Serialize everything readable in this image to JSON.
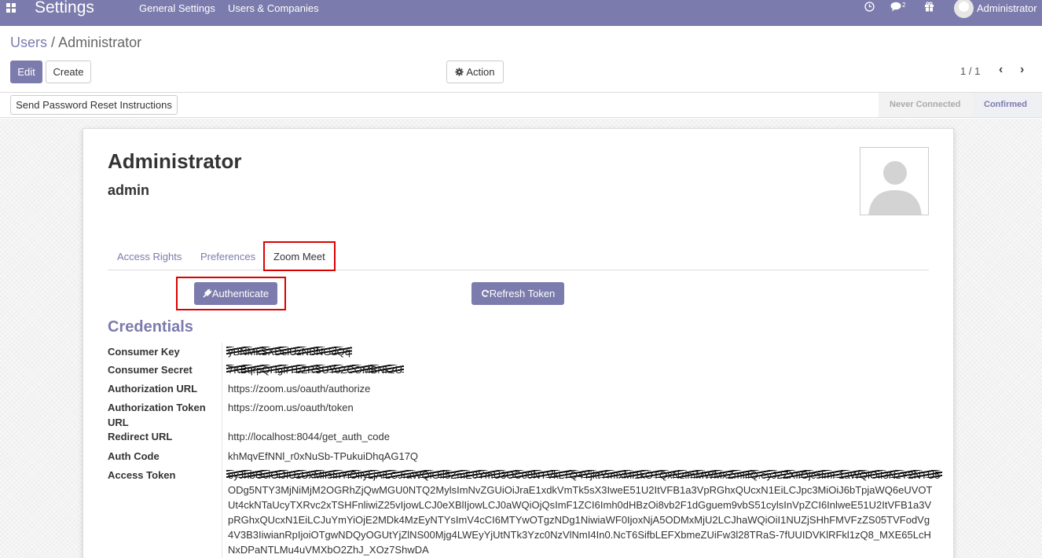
{
  "navbar": {
    "brand": "Settings",
    "menu": [
      "General Settings",
      "Users & Companies"
    ],
    "messages_count": "2",
    "user": "Administrator"
  },
  "breadcrumb": {
    "parent": "Users",
    "separator": "/",
    "current": "Administrator"
  },
  "buttons": {
    "edit": "Edit",
    "create": "Create",
    "action": "Action",
    "reset_password": "Send Password Reset Instructions",
    "authenticate": "Authenticate",
    "refresh_token": "Refresh Token"
  },
  "pager": {
    "value": "1 / 1"
  },
  "statusbar": {
    "never_connected": "Never Connected",
    "confirmed": "Confirmed"
  },
  "user": {
    "name": "Administrator",
    "login": "admin"
  },
  "tabs": [
    {
      "label": "Access Rights",
      "active": false
    },
    {
      "label": "Preferences",
      "active": false
    },
    {
      "label": "Zoom Meet",
      "active": true
    }
  ],
  "credentials": {
    "title": "Credentials",
    "consumer_key_label": "Consumer Key",
    "consumer_key": "yBNMkSXDsiUzNBNGdQq",
    "consumer_secret_label": "Consumer Secret",
    "consumer_secret": "7KBqrpQHgfrTbZRSUYoZCOMBNkzU",
    "auth_url_label": "Authorization URL",
    "auth_url": "https://zoom.us/oauth/authorize",
    "auth_token_url_label_1": "Authorization Token",
    "auth_token_url_label_2": "URL",
    "auth_token_url": "https://zoom.us/oauth/token",
    "redirect_url_label": "Redirect URL",
    "redirect_url": "http://localhost:8044/get_auth_code",
    "auth_code_label": "Auth Code",
    "auth_code": "khMqvEfNNl_r0xNuSb-TPukuiDhqAG17Q",
    "access_token_label": "Access Token",
    "access_token_lines": [
      "eyJhbGciOiJIUzUxMiIsInYiOiIyLjAiLCJraWQiOiI5ZmE0YmU3OC00NTVkLTQ4YjktYmIxMi1kOTQxNzlmMWMxZmIifQ.eyJ2ZXIiOjcsImF1aWQiOiI3NzY2NTU5",
      "ODg5NTY3MjNiMjM2OGRhZjQwMGU0NTQ2MylsImNvZGUiOiJraE1xdkVmTk5sX3IweE51U2ItVFB1a3VpRGhxQUcxN1EiLCJpc3MiOiJ6bTpjaWQ6eUVOT",
      "Ut4ckNTaUcyTXRvc2xTSHFnliwiZ25vIjowLCJ0eXBlIjowLCJ0aWQiOjQsImF1ZCI6Imh0dHBzOi8vb2F1dGguem9vbS51cylsInVpZCI6InlweE51U2ItVFB1a3V",
      "pRGhxQUcxN1EiLCJuYmYiOjE2MDk4MzEyNTYsImV4cCI6MTYwOTgzNDg1NiwiaWF0IjoxNjA5ODMxMjU2LCJhaWQiOiI1NUZjSHhFMVFzZS05TVFodVg",
      "4V3B3IiwianRpIjoiOTgwNDQyOGUtYjZlNS00Mjg4LWEyYjUtNTk3Yzc0NzVlNmI4In0.NcT6SifbLEFXbmeZUiFw3l28TRaS-7fUUIDVKlRFkl1zQ8_MXE65LcH",
      "NxDPaNTLMu4uVMXbO2ZhJ_XOz7ShwDA"
    ]
  },
  "icons": {
    "apps": "apps-grid-icon",
    "clock": "clock-icon",
    "chat": "chat-icon",
    "gift": "gift-icon",
    "gear": "gear-icon",
    "plug": "plug-icon",
    "refresh": "refresh-icon"
  },
  "colors": {
    "brand": "#7c7bad",
    "highlight": "#dd0000"
  }
}
